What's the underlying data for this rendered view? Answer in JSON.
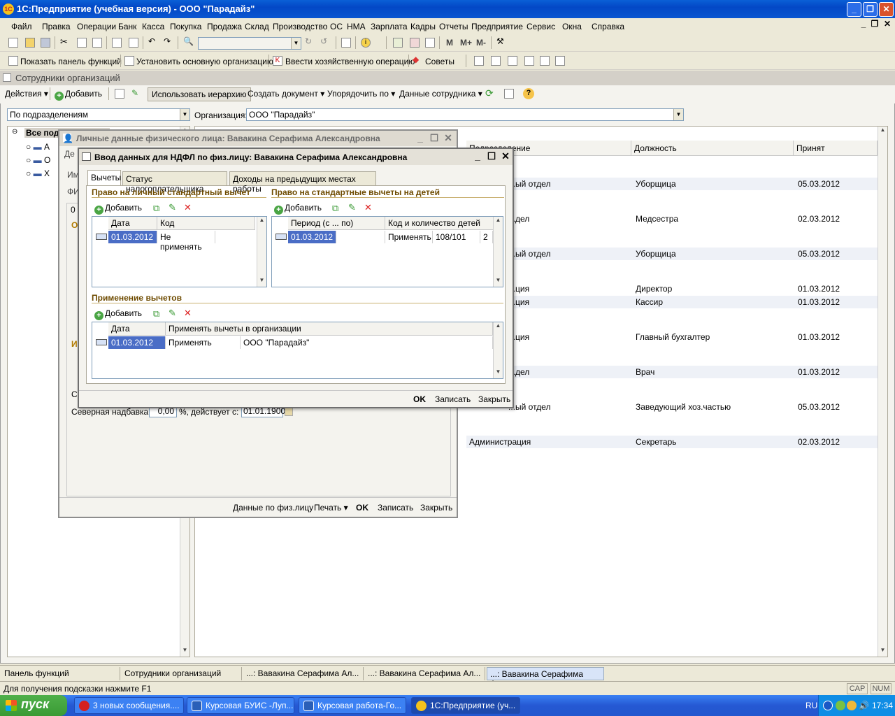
{
  "app": {
    "title": "1С:Предприятие (учебная версия) - ООО \"Парадайз\"",
    "icon_label": "1С"
  },
  "menu": [
    "Файл",
    "Правка",
    "Операции",
    "Банк",
    "Касса",
    "Покупка",
    "Продажа",
    "Склад",
    "Производство",
    "ОС",
    "НМА",
    "Зарплата",
    "Кадры",
    "Отчеты",
    "Предприятие",
    "Сервис",
    "Окна",
    "Справка"
  ],
  "toolbar2": {
    "show_panel": "Показать панель функций",
    "set_org": "Установить основную организацию",
    "enter_op": "Ввести хозяйственную операцию",
    "tips": "Советы",
    "m_buttons": [
      "M",
      "M+",
      "M-"
    ]
  },
  "doc": {
    "title": "Сотрудники организаций",
    "actions": "Действия",
    "add": "Добавить",
    "use_hierarchy": "Использовать иерархию",
    "create_doc": "Создать документ",
    "sort_by": "Упорядочить по",
    "employee_data": "Данные сотрудника",
    "filter_value": "По подразделениям",
    "org_label": "Организация:",
    "org_value": "ООО \"Парадайз\"",
    "tree_root": "Все подразделения",
    "tree_items": [
      "А",
      "О",
      "Х"
    ],
    "columns": [
      "Подразделение",
      "Должность",
      "Принят"
    ],
    "rows": [
      {
        "dept": "...ый отдел",
        "pos": "Уборщица",
        "date": "05.03.2012"
      },
      {
        "dept": "...дел",
        "pos": "Медсестра",
        "date": "02.03.2012"
      },
      {
        "dept": "...ый отдел",
        "pos": "Уборщица",
        "date": "05.03.2012"
      },
      {
        "dept": "...ция",
        "pos": "Директор",
        "date": "01.03.2012"
      },
      {
        "dept": "...ция",
        "pos": "Кассир",
        "date": "01.03.2012"
      },
      {
        "dept": "...ция",
        "pos": "Главный бухгалтер",
        "date": "01.03.2012"
      },
      {
        "dept": "...дел",
        "pos": "Врач",
        "date": "01.03.2012"
      },
      {
        "dept": "...ый отдел",
        "pos": "Заведующий хоз.частью",
        "date": "05.03.2012"
      },
      {
        "dept": "Администрация",
        "pos": "Секретарь",
        "date": "02.03.2012"
      }
    ]
  },
  "dlg1": {
    "title": "Личные данные физического лица: Вавакина Серафима Александровна",
    "north_label": "Северная надбавка:",
    "north_value": "0,00",
    "percent": "%,",
    "valid_from": "действует с:",
    "valid_date": "01.01.1900",
    "btn_person_data": "Данные по физ.лицу",
    "btn_print": "Печать",
    "btn_ok": "OK",
    "btn_save": "Записать",
    "btn_close": "Закрыть"
  },
  "dlg2": {
    "title": "Ввод данных для НДФЛ по физ.лицу: Вавакина Серафима Александровна",
    "tabs": [
      "Вычеты",
      "Статус налогоплательщика",
      "Доходы на предыдущих местах работы"
    ],
    "sect_personal": "Право на личный стандартный вычет",
    "sect_children": "Право на стандартные вычеты на детей",
    "sect_apply": "Применение вычетов",
    "add": "Добавить",
    "personal_cols": [
      "Дата",
      "Код"
    ],
    "personal_row": {
      "date": "01.03.2012",
      "code": "Не применять"
    },
    "children_cols": [
      "Период (с ... по)",
      "Код и количество детей"
    ],
    "children_row": {
      "period": "01.03.2012",
      "apply": "Применять",
      "code": "108/101",
      "count": "2"
    },
    "apply_cols": [
      "Дата",
      "Применять вычеты в организации"
    ],
    "apply_row": {
      "date": "01.03.2012",
      "apply": "Применять",
      "org": "ООО \"Парадайз\""
    },
    "btn_ok": "OK",
    "btn_save": "Записать",
    "btn_close": "Закрыть"
  },
  "winbar": [
    "Панель функций",
    "Сотрудники организаций",
    "...: Вавакина Серафима Ал...",
    "...: Вавакина Серафима Ал...",
    "...: Вавакина Серафима Ал..."
  ],
  "status": {
    "hint": "Для получения подсказки нажмите F1",
    "cap": "CAP",
    "num": "NUM"
  },
  "taskbar": {
    "start": "пуск",
    "tasks": [
      "3 новых сообщения....",
      "Курсовая БУИС -Луп...",
      "Курсовая работа-Го...",
      "1С:Предприятие (уч..."
    ],
    "lang": "RU",
    "time": "17:34"
  }
}
